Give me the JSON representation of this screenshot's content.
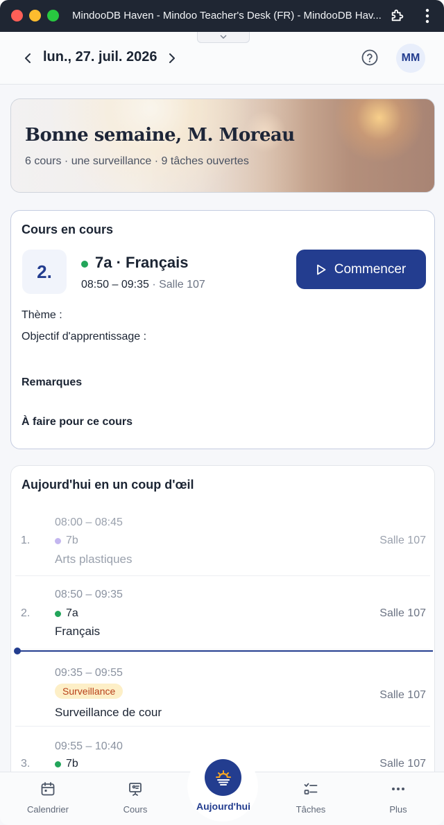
{
  "window": {
    "title": "MindooDB Haven - Mindoo Teacher's Desk (FR) - MindooDB Hav..."
  },
  "header": {
    "date": "lun., 27. juil. 2026",
    "avatar_initials": "MM"
  },
  "hero": {
    "greeting": "Bonne semaine, M. Moreau",
    "summary": "6 cours · une surveillance · 9 tâches ouvertes"
  },
  "current_lesson": {
    "heading": "Cours en cours",
    "period": "2.",
    "title": "7a · Français",
    "time": "08:50 – 09:35",
    "room": " · Salle 107",
    "start_label": "Commencer",
    "theme_label": "Thème :",
    "objective_label": "Objectif d'apprentissage :",
    "remarks_label": "Remarques",
    "todo_label": "À faire pour ce cours"
  },
  "today": {
    "heading": "Aujourd'hui en un coup d'œil",
    "slots": [
      {
        "num": "1.",
        "time": "08:00 – 08:45",
        "class": "7b",
        "subject": "Arts plastiques",
        "room": "Salle 107",
        "dot_color": "#c3b6ef"
      },
      {
        "num": "2.",
        "time": "08:50 – 09:35",
        "class": "7a",
        "subject": "Français",
        "room": "Salle 107",
        "dot_color": "#22a55a"
      },
      {
        "num": "",
        "time": "09:35 – 09:55",
        "badge": "Surveillance",
        "subject": "Surveillance de cour",
        "room": "Salle 107"
      },
      {
        "num": "3.",
        "time": "09:55 – 10:40",
        "class": "7b",
        "subject": "",
        "room": "Salle 107",
        "dot_color": "#22a55a"
      }
    ]
  },
  "bottom_nav": {
    "calendar": "Calendrier",
    "courses": "Cours",
    "today": "Aujourd'hui",
    "tasks": "Tâches",
    "more": "Plus"
  },
  "colors": {
    "accent": "#233d8f",
    "class_green": "#22a55a",
    "class_lilac": "#c3b6ef",
    "badge_bg": "#fdefc7",
    "badge_text": "#b8401a"
  }
}
